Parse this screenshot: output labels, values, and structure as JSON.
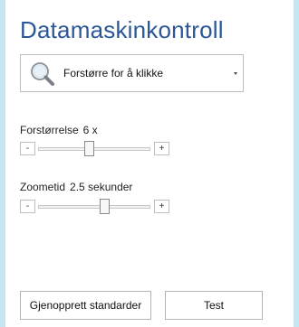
{
  "app": {
    "title": "Datamaskinkontroll"
  },
  "mode_select": {
    "icon": "magnifier-icon",
    "selected": "Forstørre for å klikke"
  },
  "magnification": {
    "label": "Forstørrelse",
    "value_text": "6 x",
    "decrement_label": "-",
    "increment_label": "+",
    "level": 0.45
  },
  "zoom_time": {
    "label": "Zoometid",
    "value_text": "2.5 sekunder",
    "decrement_label": "-",
    "increment_label": "+",
    "level": 0.6
  },
  "actions": {
    "reset_label": "Gjenopprett standarder",
    "test_label": "Test"
  },
  "colors": {
    "background": "#c6e6f1",
    "panel": "#ffffff",
    "title": "#2b5797"
  }
}
